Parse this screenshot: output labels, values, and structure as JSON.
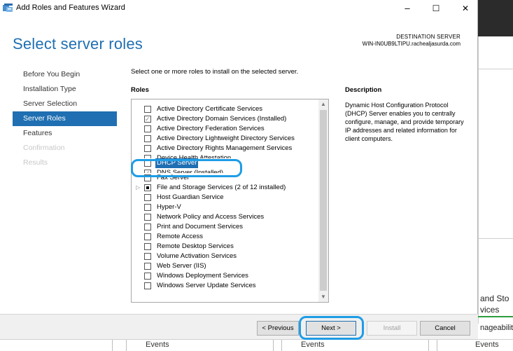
{
  "window": {
    "title": "Add Roles and Features Wizard",
    "minimize_glyph": "–",
    "maximize_glyph": "☐",
    "close_glyph": "✕"
  },
  "header": {
    "title": "Select server roles",
    "destination_label": "DESTINATION SERVER",
    "destination_name": "WIN-IN0UB9LTIPU.rachealjasurda.com"
  },
  "nav": {
    "items": [
      {
        "label": "Before You Begin",
        "state": "normal"
      },
      {
        "label": "Installation Type",
        "state": "normal"
      },
      {
        "label": "Server Selection",
        "state": "normal"
      },
      {
        "label": "Server Roles",
        "state": "active"
      },
      {
        "label": "Features",
        "state": "normal"
      },
      {
        "label": "Confirmation",
        "state": "disabled"
      },
      {
        "label": "Results",
        "state": "disabled"
      }
    ]
  },
  "content": {
    "intro": "Select one or more roles to install on the selected server.",
    "roles_heading": "Roles",
    "description_heading": "Description",
    "description": "Dynamic Host Configuration Protocol (DHCP) Server enables you to centrally configure, manage, and provide temporary IP addresses and related information for client computers.",
    "roles": [
      {
        "label": "Active Directory Certificate Services",
        "state": "unchecked"
      },
      {
        "label": "Active Directory Domain Services (Installed)",
        "state": "checked"
      },
      {
        "label": "Active Directory Federation Services",
        "state": "unchecked"
      },
      {
        "label": "Active Directory Lightweight Directory Services",
        "state": "unchecked"
      },
      {
        "label": "Active Directory Rights Management Services",
        "state": "unchecked"
      },
      {
        "label": "Device Health Attestation",
        "state": "unchecked",
        "cut": true
      },
      {
        "label": "DHCP Server",
        "state": "unchecked",
        "highlighted": true
      },
      {
        "label": "DNS Server (Installed)",
        "state": "checked",
        "cut": true
      },
      {
        "label": "Fax Server",
        "state": "unchecked"
      },
      {
        "label": "File and Storage Services (2 of 12 installed)",
        "state": "partial",
        "expander": "▷"
      },
      {
        "label": "Host Guardian Service",
        "state": "unchecked"
      },
      {
        "label": "Hyper-V",
        "state": "unchecked"
      },
      {
        "label": "Network Policy and Access Services",
        "state": "unchecked"
      },
      {
        "label": "Print and Document Services",
        "state": "unchecked"
      },
      {
        "label": "Remote Access",
        "state": "unchecked"
      },
      {
        "label": "Remote Desktop Services",
        "state": "unchecked"
      },
      {
        "label": "Volume Activation Services",
        "state": "unchecked"
      },
      {
        "label": "Web Server (IIS)",
        "state": "unchecked"
      },
      {
        "label": "Windows Deployment Services",
        "state": "unchecked"
      },
      {
        "label": "Windows Server Update Services",
        "state": "unchecked"
      }
    ],
    "scroll_up_glyph": "▲",
    "scroll_down_glyph": "▼"
  },
  "footer": {
    "previous": "< Previous",
    "next": "Next >",
    "install": "Install",
    "cancel": "Cancel"
  },
  "background": {
    "right_text_1": "and Sto",
    "right_text_2": "vices",
    "right_text_3": "nageabilit",
    "events_1": "Events",
    "events_2": "Events",
    "events_3": "Events"
  },
  "colors": {
    "accent": "#1f6fb2",
    "annotation": "#1e9de6"
  }
}
